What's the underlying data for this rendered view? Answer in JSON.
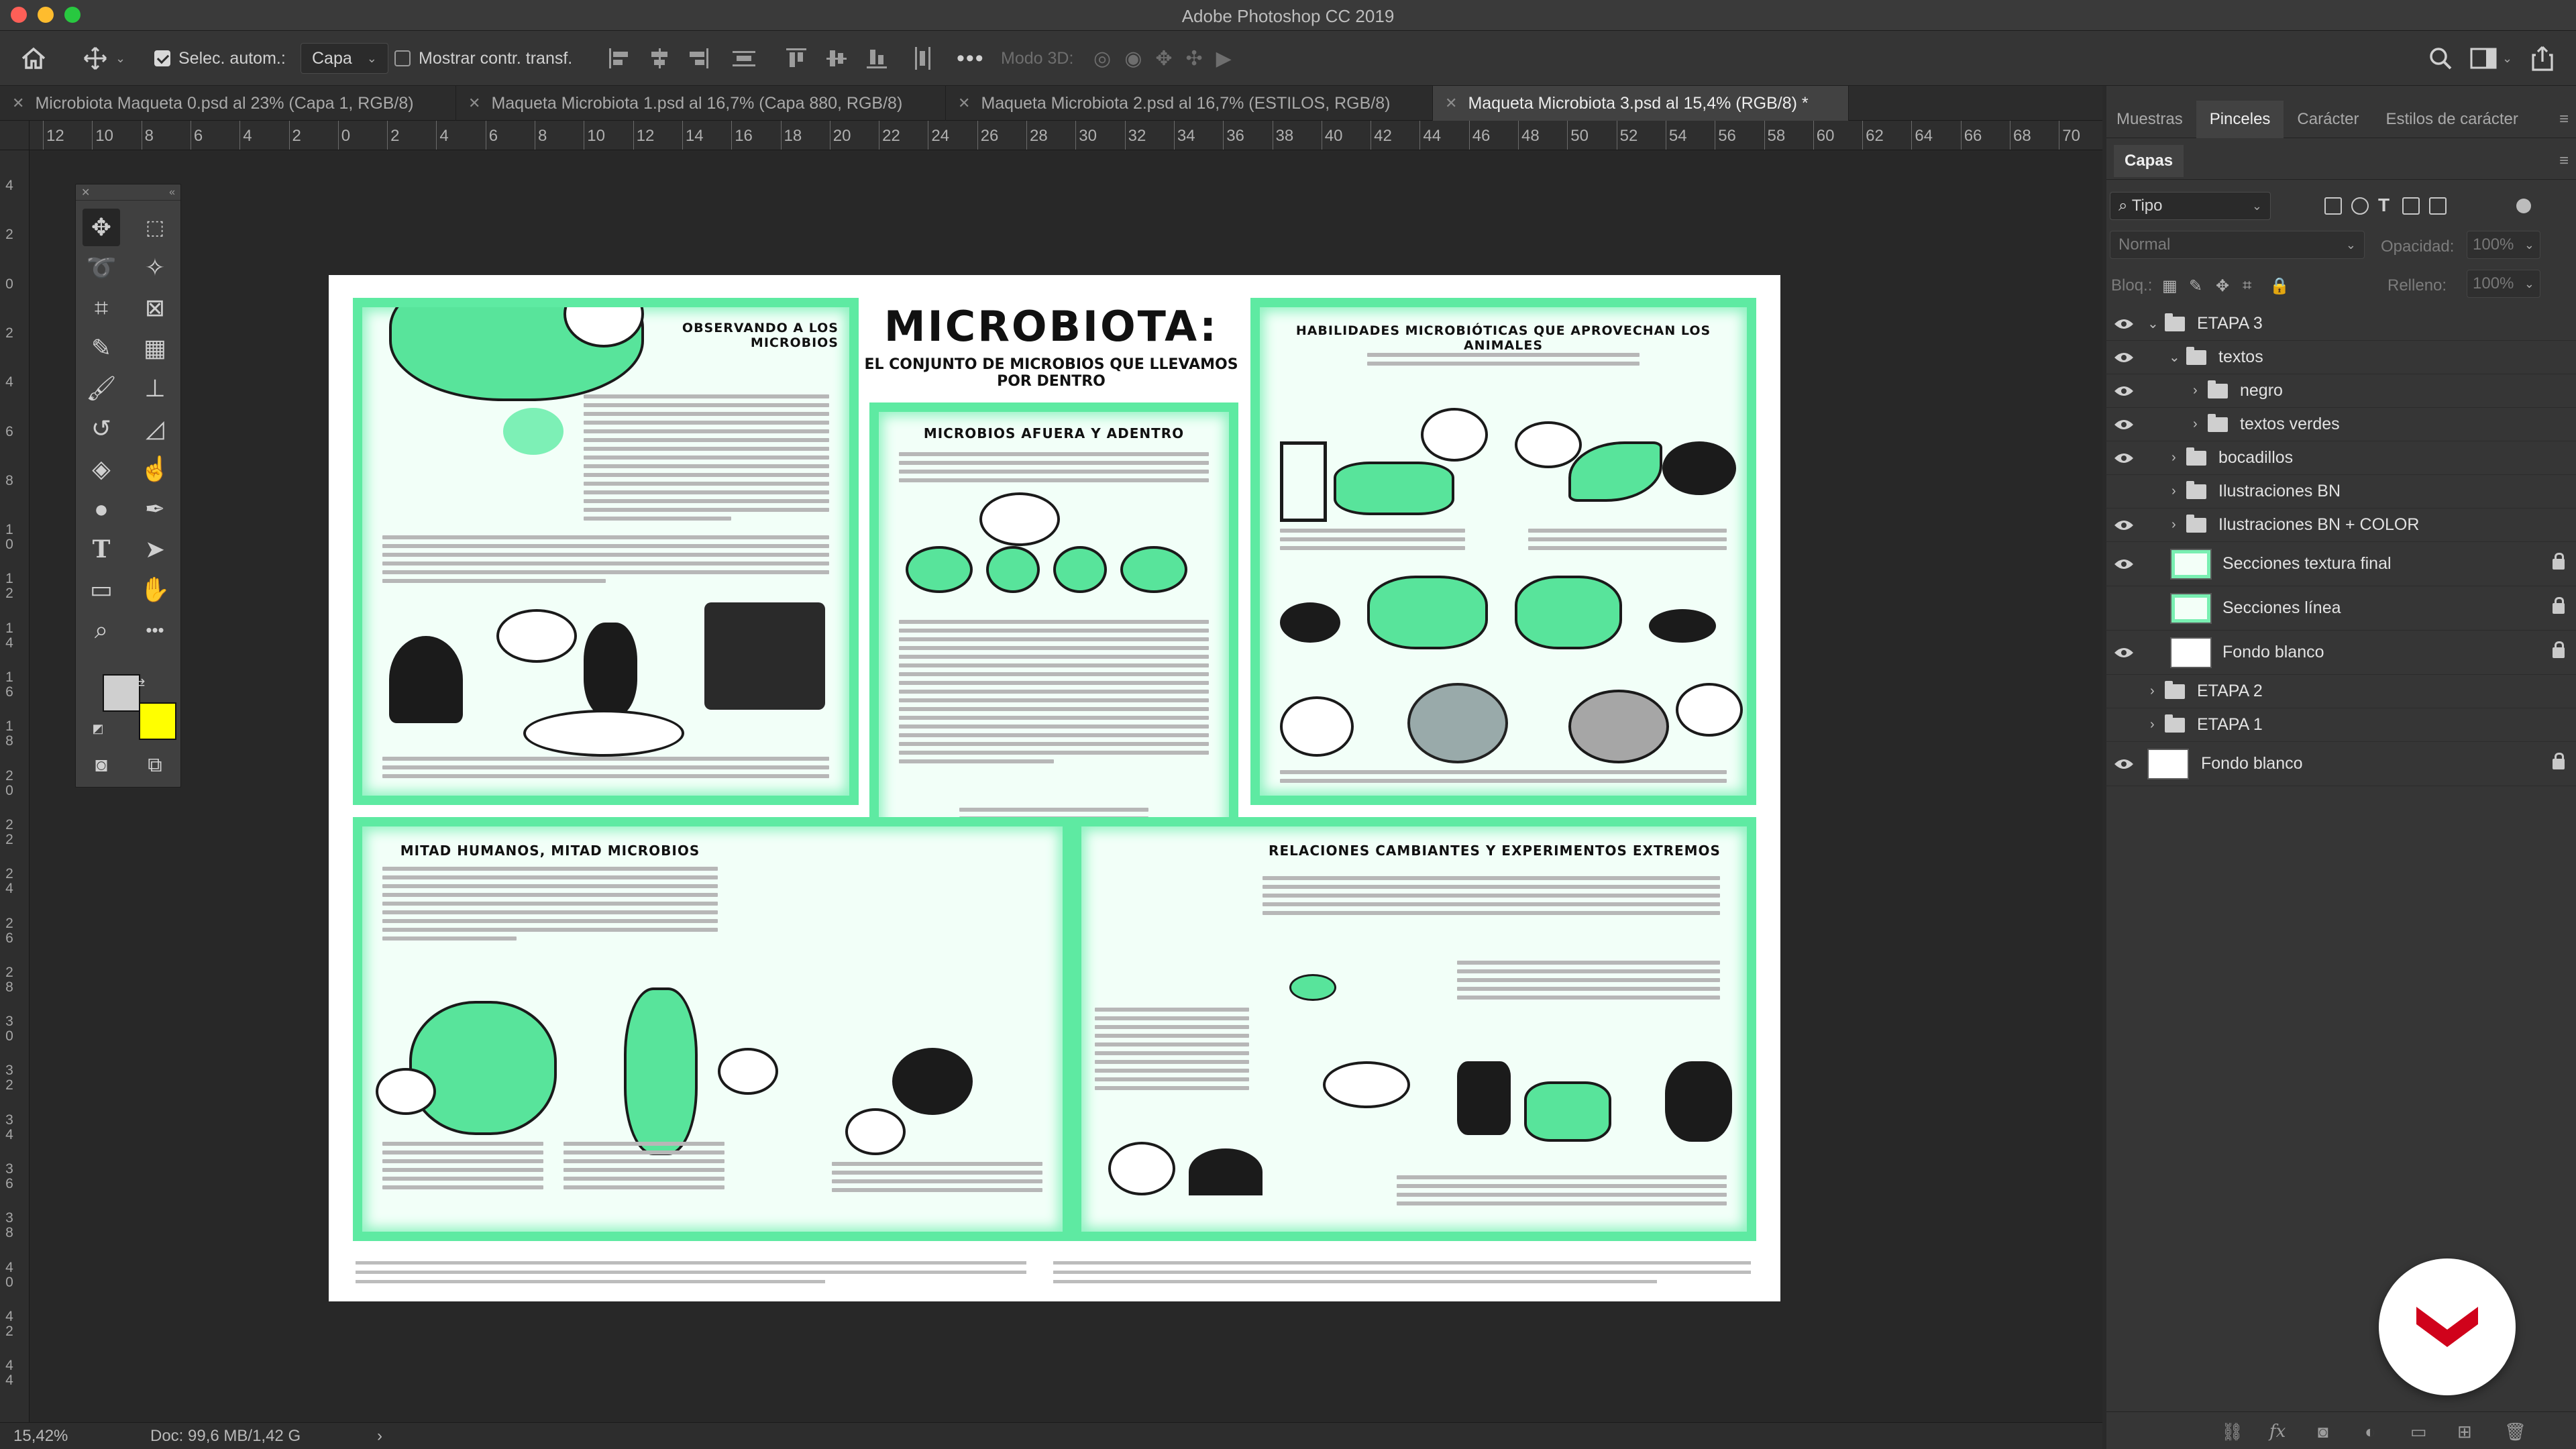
{
  "app": {
    "title": "Adobe Photoshop CC 2019"
  },
  "options": {
    "auto_select_label": "Selec. autom.:",
    "auto_select_value": "Capa",
    "show_transform_label": "Mostrar contr. transf.",
    "mode_3d_label": "Modo 3D:"
  },
  "tabs": [
    {
      "label": "Microbiota Maqueta 0.psd al 23% (Capa 1, RGB/8)",
      "active": false
    },
    {
      "label": "Maqueta Microbiota 1.psd al 16,7% (Capa 880, RGB/8)",
      "active": false
    },
    {
      "label": "Maqueta Microbiota 2.psd al 16,7% (ESTILOS, RGB/8)",
      "active": false
    },
    {
      "label": "Maqueta Microbiota 3.psd al 15,4% (RGB/8) *",
      "active": true
    }
  ],
  "ruler_top": [
    "12",
    "10",
    "8",
    "6",
    "4",
    "2",
    "0",
    "2",
    "4",
    "6",
    "8",
    "10",
    "12",
    "14",
    "16",
    "18",
    "20",
    "22",
    "24",
    "26",
    "28",
    "30",
    "32",
    "34",
    "36",
    "38",
    "40",
    "42",
    "44",
    "46",
    "48",
    "50",
    "52",
    "54",
    "56",
    "58",
    "60",
    "62",
    "64",
    "66",
    "68",
    "70"
  ],
  "ruler_left": [
    "4",
    "2",
    "0",
    "2",
    "4",
    "6",
    "8",
    "1 0",
    "1 2",
    "1 4",
    "1 6",
    "1 8",
    "2 0",
    "2 2",
    "2 4",
    "2 6",
    "2 8",
    "3 0",
    "3 2",
    "3 4",
    "3 6",
    "3 8",
    "4 0",
    "4 2",
    "4 4"
  ],
  "document": {
    "title": "MICROBIOTA:",
    "subtitle": "EL CONJUNTO DE MICROBIOS QUE LLEVAMOS POR DENTRO",
    "sections": {
      "observando": "OBSERVANDO A LOS MICROBIOS",
      "afuera": "MICROBIOS AFUERA Y ADENTRO",
      "habilidades": "HABILIDADES MICROBIÓTICAS QUE APROVECHAN LOS ANIMALES",
      "mitad": "MITAD HUMANOS, MITAD MICROBIOS",
      "relaciones": "RELACIONES CAMBIANTES Y EXPERIMENTOS EXTREMOS"
    }
  },
  "right_panel": {
    "tabs": [
      "Muestras",
      "Pinceles",
      "Carácter",
      "Estilos de carácter"
    ],
    "active_tab": "Pinceles",
    "layers_title": "Capas",
    "filter_kind": "Tipo",
    "blend_mode": "Normal",
    "opacity_label": "Opacidad:",
    "opacity_value": "100%",
    "lock_label": "Bloq.:",
    "fill_label": "Relleno:",
    "fill_value": "100%",
    "layers": [
      {
        "name": "ETAPA 3",
        "type": "group",
        "visible": true,
        "open": true,
        "indent": 0
      },
      {
        "name": "textos",
        "type": "group",
        "visible": true,
        "open": true,
        "indent": 1
      },
      {
        "name": "negro",
        "type": "group",
        "visible": true,
        "open": false,
        "indent": 2
      },
      {
        "name": "textos verdes",
        "type": "group",
        "visible": true,
        "open": false,
        "indent": 2
      },
      {
        "name": "bocadillos",
        "type": "group",
        "visible": true,
        "open": false,
        "indent": 1
      },
      {
        "name": "Ilustraciones BN",
        "type": "group",
        "visible": false,
        "open": false,
        "indent": 1
      },
      {
        "name": "Ilustraciones BN + COLOR",
        "type": "group",
        "visible": true,
        "open": false,
        "indent": 1
      },
      {
        "name": "Secciones textura final",
        "type": "layer",
        "visible": true,
        "locked": true,
        "indent": 1
      },
      {
        "name": "Secciones línea",
        "type": "layer",
        "visible": false,
        "locked": true,
        "indent": 1
      },
      {
        "name": "Fondo blanco",
        "type": "layer",
        "visible": true,
        "locked": true,
        "indent": 1
      },
      {
        "name": "ETAPA 2",
        "type": "group",
        "visible": false,
        "open": false,
        "indent": 0
      },
      {
        "name": "ETAPA 1",
        "type": "group",
        "visible": false,
        "open": false,
        "indent": 0
      },
      {
        "name": "Fondo blanco",
        "type": "layer",
        "visible": true,
        "locked": true,
        "indent": 0
      }
    ]
  },
  "status": {
    "zoom": "15,42%",
    "doc_size": "Doc: 99,6 MB/1,42 G"
  },
  "colors": {
    "foreground": "#cfcfcf",
    "background": "#ffff00",
    "accent_green": "#5eeaa2",
    "brand_red": "#d0021b"
  }
}
